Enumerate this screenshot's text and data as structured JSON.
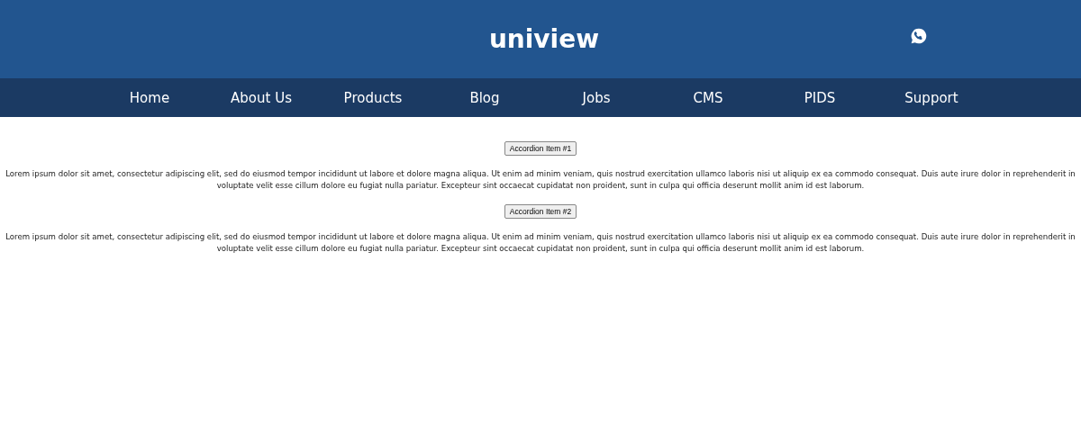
{
  "header": {
    "logo": "uniview"
  },
  "nav": {
    "items": [
      {
        "label": "Home"
      },
      {
        "label": "About Us"
      },
      {
        "label": "Products"
      },
      {
        "label": "Blog"
      },
      {
        "label": "Jobs"
      },
      {
        "label": "CMS"
      },
      {
        "label": "PIDS"
      },
      {
        "label": "Support"
      }
    ]
  },
  "accordion": [
    {
      "title": "Accordion Item #1",
      "body": "Lorem ipsum dolor sit amet, consectetur adipiscing elit, sed do eiusmod tempor incididunt ut labore et dolore magna aliqua. Ut enim ad minim veniam, quis nostrud exercitation ullamco laboris nisi ut aliquip ex ea commodo consequat. Duis aute irure dolor in reprehenderit in voluptate velit esse cillum dolore eu fugiat nulla pariatur. Excepteur sint occaecat cupidatat non proident, sunt in culpa qui officia deserunt mollit anim id est laborum."
    },
    {
      "title": "Accordion Item #2",
      "body": "Lorem ipsum dolor sit amet, consectetur adipiscing elit, sed do eiusmod tempor incididunt ut labore et dolore magna aliqua. Ut enim ad minim veniam, quis nostrud exercitation ullamco laboris nisi ut aliquip ex ea commodo consequat. Duis aute irure dolor in reprehenderit in voluptate velit esse cillum dolore eu fugiat nulla pariatur. Excepteur sint occaecat cupidatat non proident, sunt in culpa qui officia deserunt mollit anim id est laborum."
    }
  ]
}
